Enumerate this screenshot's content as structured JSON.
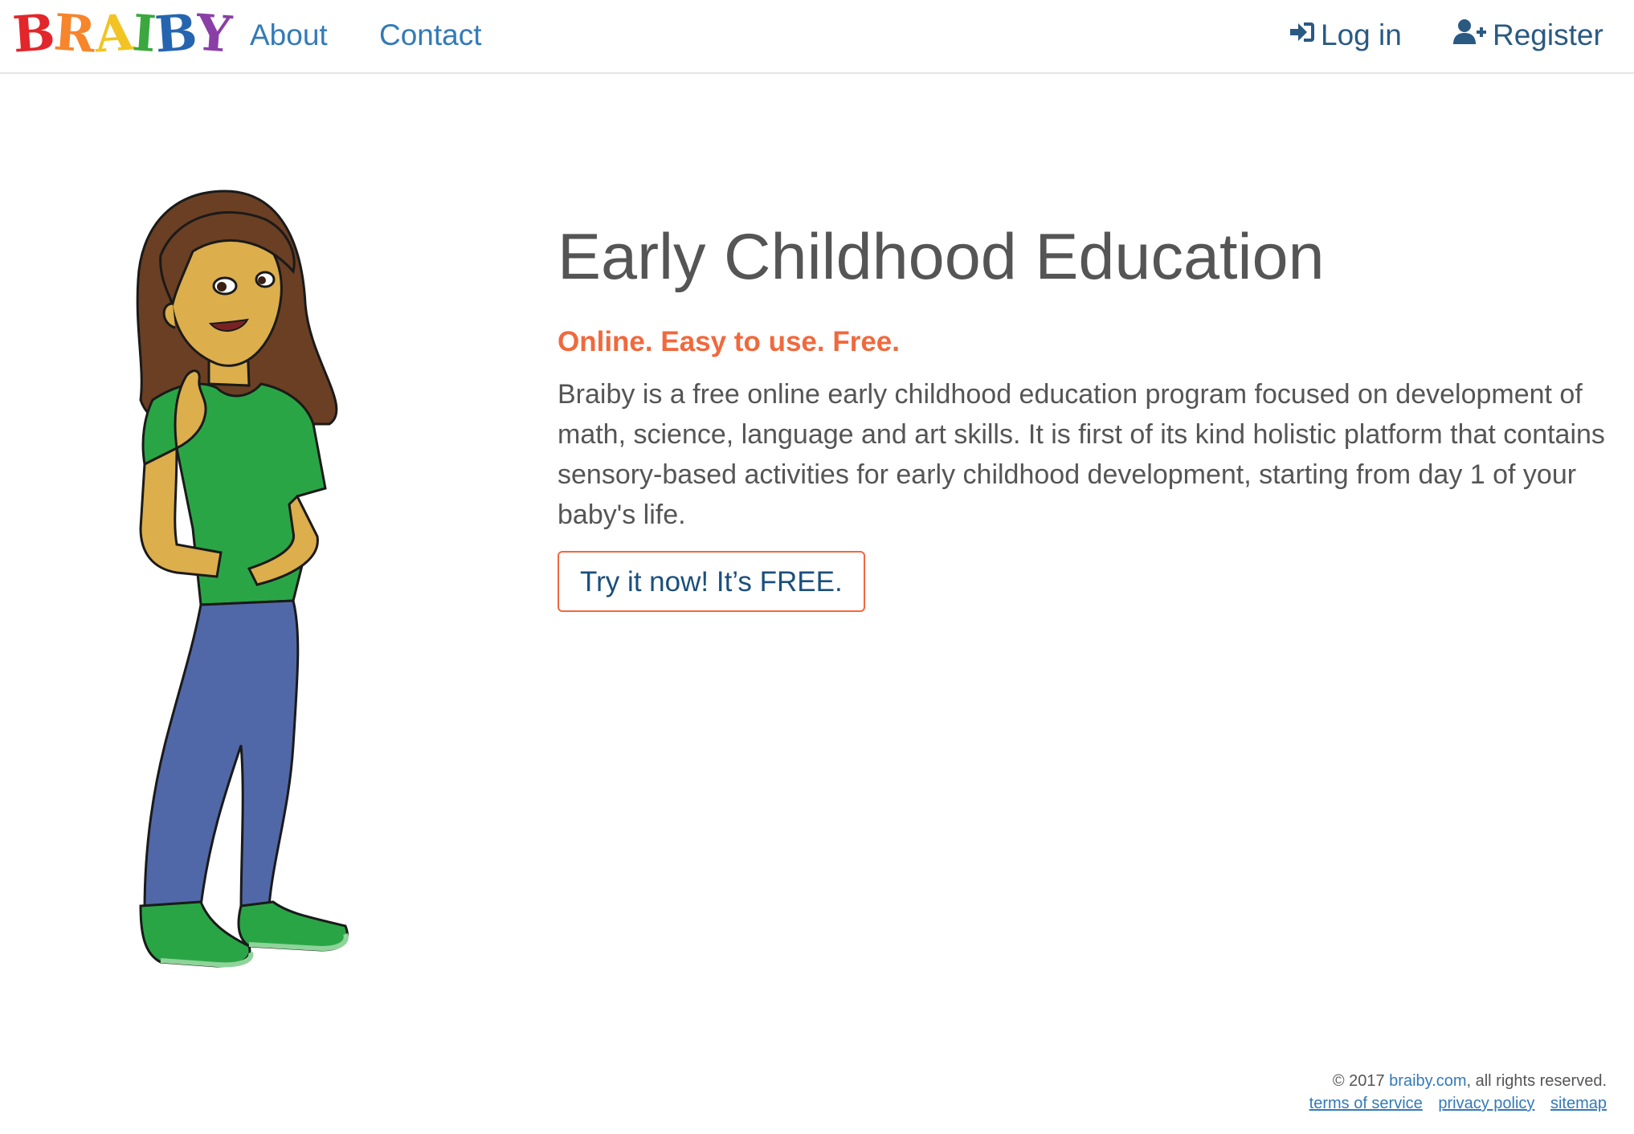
{
  "header": {
    "logo_letters": [
      {
        "char": "B",
        "color": "#e3262b"
      },
      {
        "char": "R",
        "color": "#f6852c"
      },
      {
        "char": "A",
        "color": "#f2c423"
      },
      {
        "char": "I",
        "color": "#3aa83f"
      },
      {
        "char": "B",
        "color": "#2565b0"
      },
      {
        "char": "Y",
        "color": "#8a3fa6"
      }
    ],
    "logo_text": "BRAIBY",
    "nav": {
      "about": "About",
      "contact": "Contact",
      "login": "Log in",
      "register": "Register"
    },
    "icons": {
      "login": "sign-in-icon",
      "register": "user-plus-icon"
    }
  },
  "hero": {
    "title": "Early Childhood Education",
    "tagline": "Online. Easy to use. Free.",
    "description": "Braiby is a free online early childhood education program focused on development of math, science, language and art skills. It is first of its kind holistic platform that contains sensory-based activities for early childhood development, starting from day 1 of your baby's life.",
    "cta_label": "Try it now! It’s FREE."
  },
  "footer": {
    "copyright_prefix": "© 2017 ",
    "site_link": "braiby.com",
    "copyright_suffix": ", all rights reserved.",
    "links": {
      "terms": "terms of service",
      "privacy": "privacy policy",
      "sitemap": "sitemap"
    }
  },
  "colors": {
    "link": "#337ab7",
    "accent": "#f0693d",
    "text": "#555555"
  }
}
